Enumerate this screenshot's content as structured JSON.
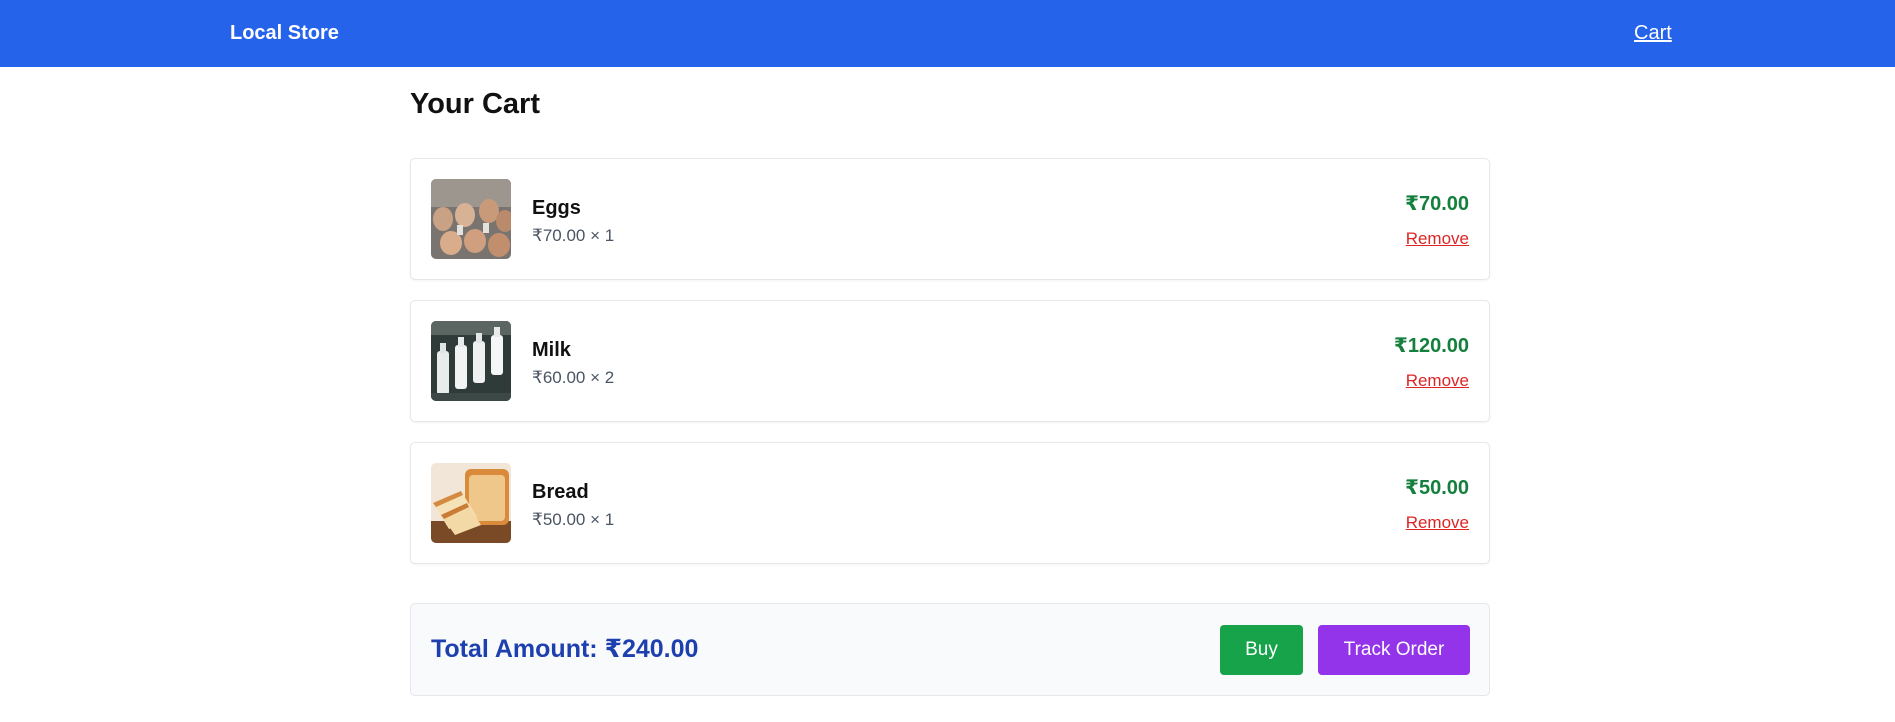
{
  "header": {
    "brand": "Local Store",
    "cart_link": "Cart",
    "background": "#2563eb"
  },
  "page": {
    "title": "Your Cart"
  },
  "cart": {
    "items": [
      {
        "name": "Eggs",
        "unit_price_qty": "₹70.00 × 1",
        "line_total": "₹70.00",
        "remove_label": "Remove",
        "image_icon": "eggs-photo"
      },
      {
        "name": "Milk",
        "unit_price_qty": "₹60.00 × 2",
        "line_total": "₹120.00",
        "remove_label": "Remove",
        "image_icon": "milk-bottles-photo"
      },
      {
        "name": "Bread",
        "unit_price_qty": "₹50.00 × 1",
        "line_total": "₹50.00",
        "remove_label": "Remove",
        "image_icon": "bread-loaf-photo"
      }
    ]
  },
  "summary": {
    "total_label": "Total Amount: ₹240.00",
    "buy_label": "Buy",
    "track_label": "Track Order"
  },
  "colors": {
    "price_green": "#15803d",
    "remove_red": "#dc2626",
    "total_blue": "#1e40af",
    "buy_green": "#16a34a",
    "track_purple": "#9333ea"
  }
}
